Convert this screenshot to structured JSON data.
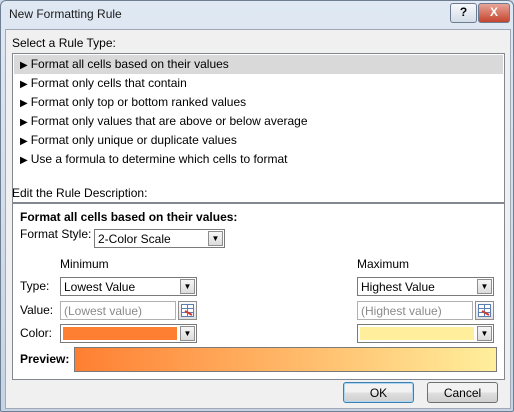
{
  "window": {
    "title": "New Formatting Rule",
    "help_label": "?",
    "close_label": "X"
  },
  "rule_type": {
    "heading": "Select a Rule Type:",
    "items": [
      {
        "label": "Format all cells based on their values",
        "selected": true
      },
      {
        "label": "Format only cells that contain",
        "selected": false
      },
      {
        "label": "Format only top or bottom ranked values",
        "selected": false
      },
      {
        "label": "Format only values that are above or below average",
        "selected": false
      },
      {
        "label": "Format only unique or duplicate values",
        "selected": false
      },
      {
        "label": "Use a formula to determine which cells to format",
        "selected": false
      }
    ]
  },
  "description": {
    "heading": "Edit the Rule Description:",
    "section_title": "Format all cells based on their values:",
    "format_style_label": "Format Style:",
    "format_style_value": "2-Color Scale",
    "minimum_label": "Minimum",
    "maximum_label": "Maximum",
    "type_label": "Type:",
    "value_label": "Value:",
    "color_label": "Color:",
    "min_type": "Lowest Value",
    "max_type": "Highest Value",
    "min_value_placeholder": "(Lowest value)",
    "max_value_placeholder": "(Highest value)",
    "min_color": "#ff7f32",
    "max_color": "#ffef9c",
    "preview_label": "Preview:"
  },
  "buttons": {
    "ok": "OK",
    "cancel": "Cancel"
  }
}
